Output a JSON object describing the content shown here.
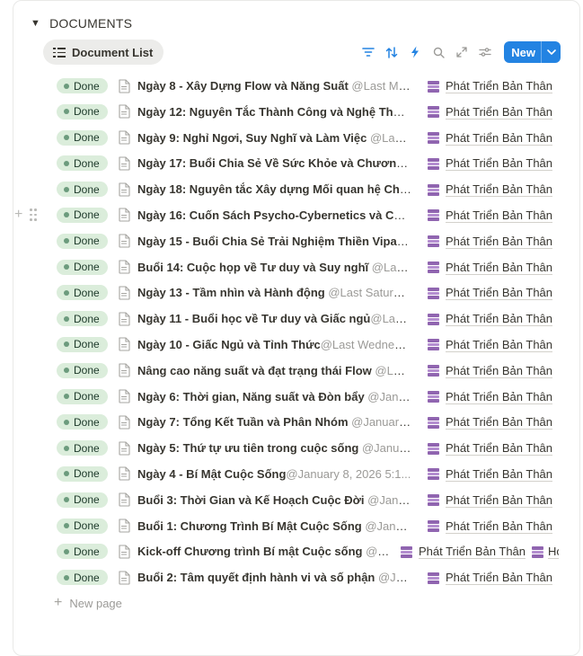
{
  "section": {
    "title": "DOCUMENTS"
  },
  "view": {
    "tab_label": "Document List"
  },
  "toolbar": {
    "icons": [
      "filter-icon",
      "sort-icon",
      "automation-icon",
      "search-icon",
      "expand-icon",
      "settings-icon"
    ],
    "new_label": "New",
    "accent": "#2383e2"
  },
  "status_color": "#dbeddb",
  "rows": [
    {
      "status": "Done",
      "title": "Ngày 8 - Xây Dựng Flow và Năng Suất",
      "mention": " @Last Mo...",
      "relation": "Phát Triển Bản Thân"
    },
    {
      "status": "Done",
      "title": "Ngày 12: Nguyên Tắc Thành Công và Nghệ Thuật...",
      "mention": "",
      "relation": "Phát Triển Bản Thân"
    },
    {
      "status": "Done",
      "title": "Ngày 9: Nghỉ Ngơi, Suy Nghĩ và Làm Việc",
      "mention": " @Last ...",
      "relation": "Phát Triển Bản Thân"
    },
    {
      "status": "Done",
      "title": "Ngày 17: Buổi Chia Sẻ Về Sức Khỏe và Chương Trì...",
      "mention": "",
      "relation": "Phát Triển Bản Thân"
    },
    {
      "status": "Done",
      "title": "Ngày 18: Nguyên tắc Xây dựng Mối quan hệ Chất...",
      "mention": "",
      "relation": "Phát Triển Bản Thân"
    },
    {
      "status": "Done",
      "title": "Ngày 16: Cuốn Sách Psycho-Cybernetics và Câu ...",
      "mention": "",
      "relation": "Phát Triển Bản Thân"
    },
    {
      "status": "Done",
      "title": "Ngày 15 - Buổi Chia Sẻ Trải Nghiệm Thiền Vipass...",
      "mention": "",
      "relation": "Phát Triển Bản Thân"
    },
    {
      "status": "Done",
      "title": "Buổi 14: Cuộc họp về Tư duy và Suy nghĩ",
      "mention": " @Last S...",
      "relation": "Phát Triển Bản Thân"
    },
    {
      "status": "Done",
      "title": "Ngày 13 - Tầm nhìn và Hành động",
      "mention": " @Last Saturda...",
      "relation": "Phát Triển Bản Thân"
    },
    {
      "status": "Done",
      "title": "Ngày 11 - Buổi học về Tư duy và Giấc ngủ",
      "mention": "@Last T...",
      "relation": "Phát Triển Bản Thân"
    },
    {
      "status": "Done",
      "title": "Ngày 10 - Giấc Ngủ và Tỉnh Thức",
      "mention": "@Last Wednesd...",
      "relation": "Phát Triển Bản Thân"
    },
    {
      "status": "Done",
      "title": "Nâng cao năng suất và đạt trạng thái Flow",
      "mention": " @Last...",
      "relation": "Phát Triển Bản Thân"
    },
    {
      "status": "Done",
      "title": "Ngày 6: Thời gian, Năng suất và Đòn bẩy",
      "mention": " @Janua...",
      "relation": "Phát Triển Bản Thân"
    },
    {
      "status": "Done",
      "title": "Ngày 7: Tổng Kết Tuần và Phân Nhóm",
      "mention": " @January ...",
      "relation": "Phát Triển Bản Thân"
    },
    {
      "status": "Done",
      "title": "Ngày 5: Thứ tự ưu tiên trong cuộc sống",
      "mention": " @Januar...",
      "relation": "Phát Triển Bản Thân"
    },
    {
      "status": "Done",
      "title": "Ngày 4 - Bí Mật Cuộc Sống",
      "mention": "@January 8, 2026 5:1...",
      "relation": "Phát Triển Bản Thân"
    },
    {
      "status": "Done",
      "title": "Buổi 3: Thời Gian và Kế Hoạch Cuộc Đời",
      "mention": " @Januar...",
      "relation": "Phát Triển Bản Thân"
    },
    {
      "status": "Done",
      "title": "Buổi 1: Chương Trình Bí Mật Cuộc Sống",
      "mention": " @Januar...",
      "relation": "Phát Triển Bản Thân"
    },
    {
      "status": "Done",
      "title": "Kick-off Chương trình Bí mật Cuộc sống",
      "mention": " @J...",
      "relation": "Phát Triển Bản Thân",
      "relation_extra": "Hợ"
    },
    {
      "status": "Done",
      "title": "Buổi 2: Tâm quyết định hành vi và số phận",
      "mention": " @Jan...",
      "relation": "Phát Triển Bản Thân"
    }
  ],
  "footer": {
    "new_page_label": "New page"
  }
}
